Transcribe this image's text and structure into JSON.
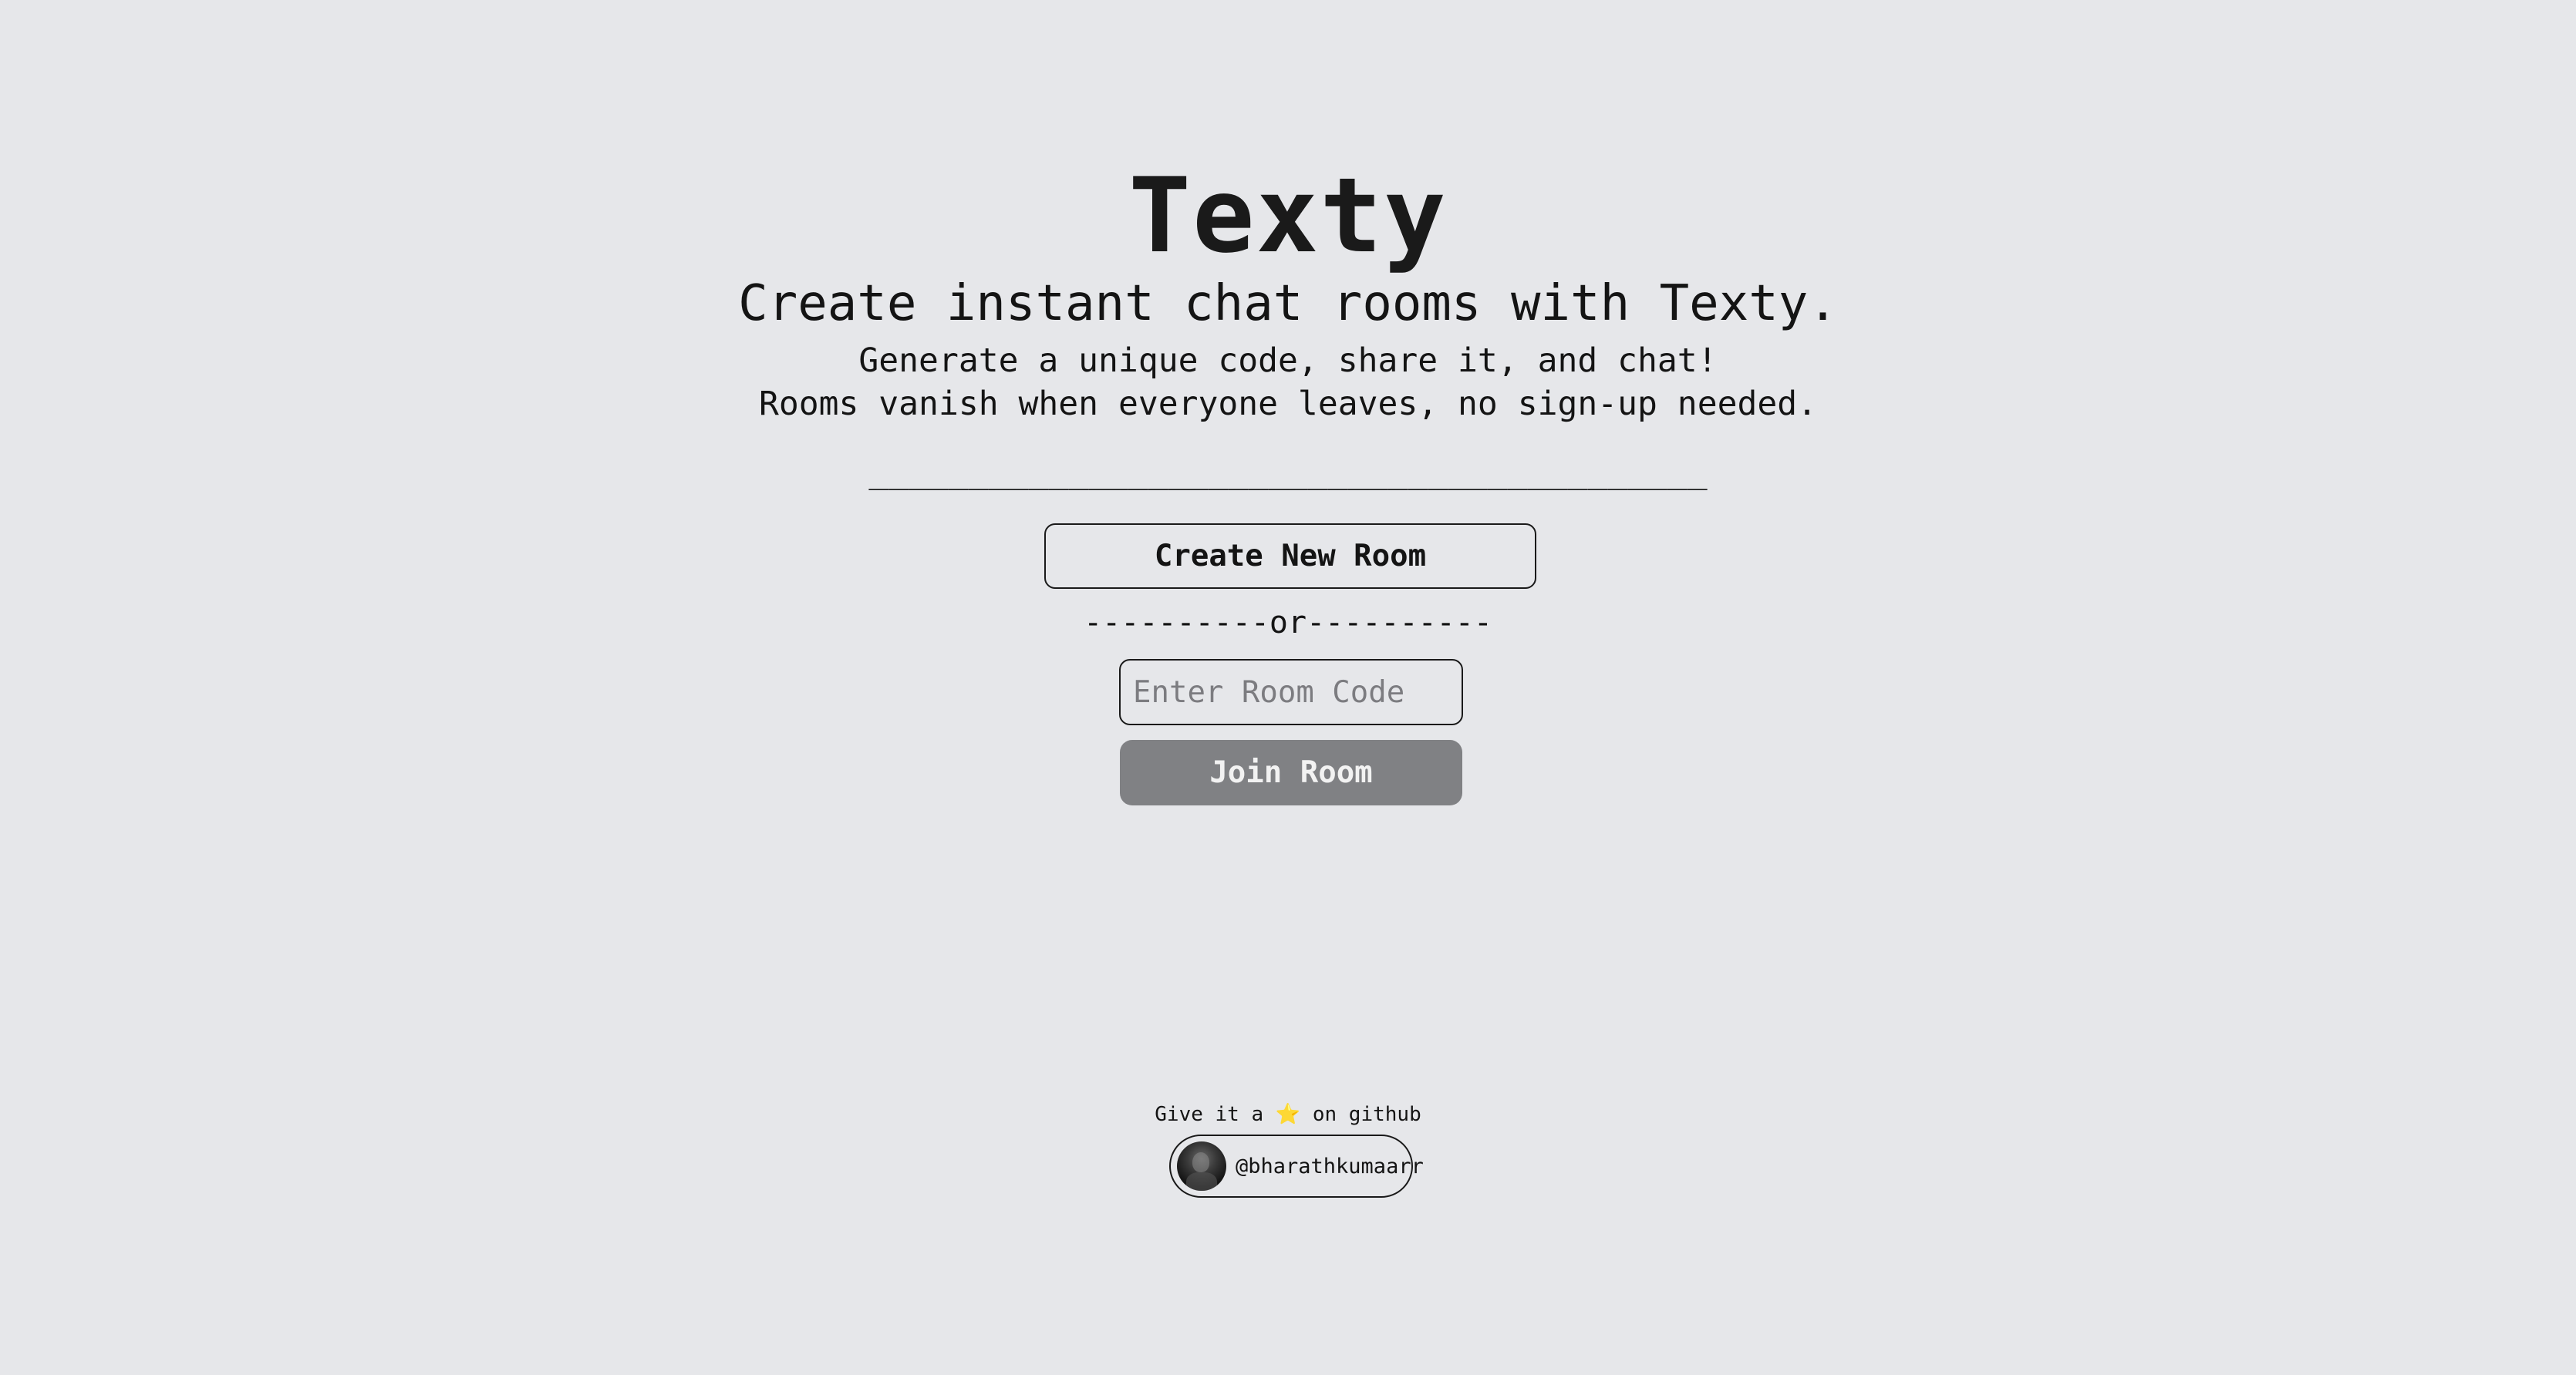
{
  "app": {
    "title": "Texty",
    "tagline": "Create instant chat rooms with Texty.",
    "description_line1": "Generate a unique code, share it, and chat!",
    "description_line2": "Rooms vanish when everyone leaves, no sign-up needed.",
    "divider": "__________________________________________"
  },
  "actions": {
    "create_label": "Create New Room",
    "or_separator": "----------or----------",
    "room_code_placeholder": "Enter Room Code",
    "room_code_value": "",
    "join_label": "Join Room",
    "join_enabled": false
  },
  "footer": {
    "prefix": "Give it a",
    "star_icon": "⭐",
    "suffix": "on github",
    "github_handle": "@bharathkumaarr",
    "avatar_icon": "avatar-photo"
  },
  "colors": {
    "background": "#e6e7ea",
    "text": "#141414",
    "join_button_bg": "#808184",
    "placeholder": "#7c7c80"
  }
}
